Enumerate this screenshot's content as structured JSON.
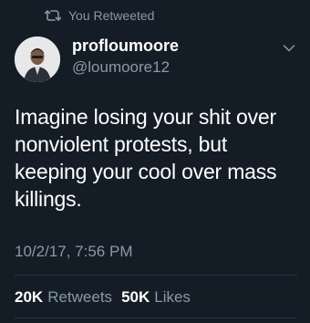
{
  "retweet_context": {
    "text": "You Retweeted",
    "icon": "retweet-icon"
  },
  "author": {
    "name": "profloumoore",
    "handle": "@loumoore12",
    "avatar": "avatar-photo"
  },
  "tweet": {
    "lines": [
      "Imagine losing your shit over",
      "nonviolent protests, but",
      "keeping your cool over mass",
      "killings."
    ],
    "timestamp": "10/2/17, 7:56 PM"
  },
  "stats": {
    "retweets_count": "20K",
    "retweets_label": "Retweets",
    "likes_count": "50K",
    "likes_label": "Likes"
  },
  "colors": {
    "background": "#141d26",
    "secondary_text": "#8899a6",
    "divider": "#253341"
  }
}
